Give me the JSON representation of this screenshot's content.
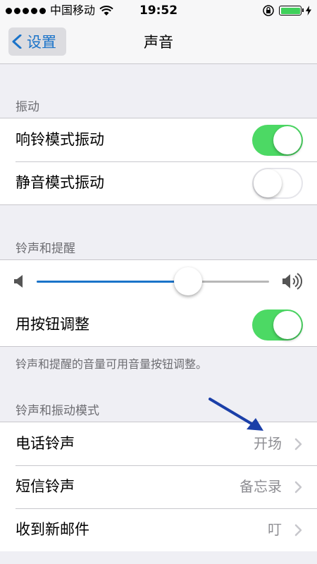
{
  "status_bar": {
    "carrier": "中国移动",
    "time": "19:52"
  },
  "nav": {
    "back_label": "设置",
    "title": "声音"
  },
  "vibration": {
    "header": "振动",
    "rows": [
      {
        "label": "响铃模式振动",
        "on": true
      },
      {
        "label": "静音模式振动",
        "on": false
      }
    ]
  },
  "ringer": {
    "header": "铃声和提醒",
    "volume": 0.65,
    "button_adjust_label": "用按钮调整",
    "button_adjust_on": true,
    "footer": "铃声和提醒的音量可用音量按钮调整。"
  },
  "patterns": {
    "header": "铃声和振动模式",
    "rows": [
      {
        "label": "电话铃声",
        "value": "开场"
      },
      {
        "label": "短信铃声",
        "value": "备忘录"
      },
      {
        "label": "收到新邮件",
        "value": "叮"
      }
    ]
  },
  "colors": {
    "accent": "#1a73c9",
    "toggle_on": "#4cd964",
    "annotation_arrow": "#1b3fa8"
  }
}
